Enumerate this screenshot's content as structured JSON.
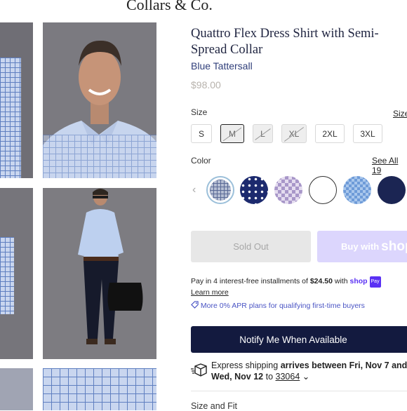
{
  "brand": "Collars & Co.",
  "product": {
    "title": "Quattro Flex Dress Shirt with Semi-Spread Collar",
    "color_name": "Blue Tattersall",
    "price": "$98.00"
  },
  "size": {
    "label": "Size",
    "guide_link": "Size",
    "options": [
      {
        "label": "S",
        "state": "available"
      },
      {
        "label": "M",
        "state": "selected-unavailable"
      },
      {
        "label": "L",
        "state": "unavailable"
      },
      {
        "label": "XL",
        "state": "unavailable"
      },
      {
        "label": "2XL",
        "state": "available"
      },
      {
        "label": "3XL",
        "state": "available"
      }
    ]
  },
  "color": {
    "label": "Color",
    "see_all": "See All 19",
    "prev_icon": "chevron-left-icon",
    "swatches": [
      "blue tattersall",
      "navy print",
      "lavender check",
      "white",
      "blue houndstooth",
      "navy"
    ]
  },
  "actions": {
    "sold_out": "Sold Out",
    "shop_pay_prefix": "Buy with",
    "shop_pay_brand": "shop",
    "notify": "Notify Me When Available"
  },
  "installments": {
    "text_prefix": "Pay in 4 interest-free installments of",
    "amount": "$24.50",
    "text_with": "with",
    "provider": "shop",
    "badge": "Pay",
    "learn_more": "Learn more",
    "apr_text": "More 0% APR plans for qualifying first-time buyers"
  },
  "shipping": {
    "prefix": "Express shipping",
    "bold": "arrives between Fri, Nov 7 and",
    "end_date": "Wed, Nov 12",
    "to": "to",
    "zip": "33064"
  },
  "section": {
    "size_fit": "Size and Fit"
  },
  "colors": {
    "primary_navy": "#131a3f",
    "shop_pay_purple": "#5a31f4",
    "price_gray": "#b8b3ad"
  }
}
